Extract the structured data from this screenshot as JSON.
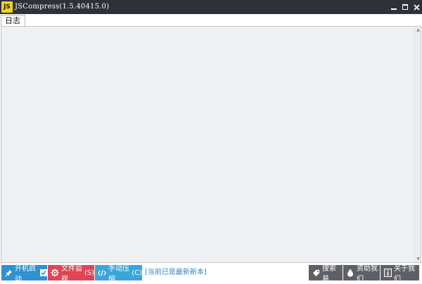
{
  "window": {
    "title": "JSCompress(1.5.40415.0)",
    "icon_text": "JS",
    "controls": {
      "minimize": "minimize-icon",
      "maximize": "maximize-icon",
      "close": "close-icon"
    }
  },
  "tabs": [
    {
      "label": "日志"
    }
  ],
  "content": {
    "log_text": ""
  },
  "toolbar": {
    "startup": {
      "label": "开机启动",
      "icon": "pin-icon",
      "checked": true
    },
    "monitor": {
      "label": "文件监视",
      "shortcut": "(S)",
      "icon": "gear-icon"
    },
    "manual": {
      "label": "手动压缩",
      "shortcut": "(C)",
      "icon": "code-icon"
    },
    "status": "[当前已是最新新本]",
    "sousuo": {
      "label": "搜索易",
      "icon": "tag-icon"
    },
    "donate": {
      "label": "资助我们",
      "icon": "drop-icon"
    },
    "about": {
      "label": "关于我们",
      "icon": "info-icon"
    }
  },
  "colors": {
    "titlebar": "#2e3138",
    "startup_button": "#2e91d2",
    "monitor_button": "#e04555",
    "manual_button": "#3aa6d8",
    "gray_button": "#5d6064",
    "status_text": "#2e86c1",
    "log_background": "#eff0f1"
  }
}
